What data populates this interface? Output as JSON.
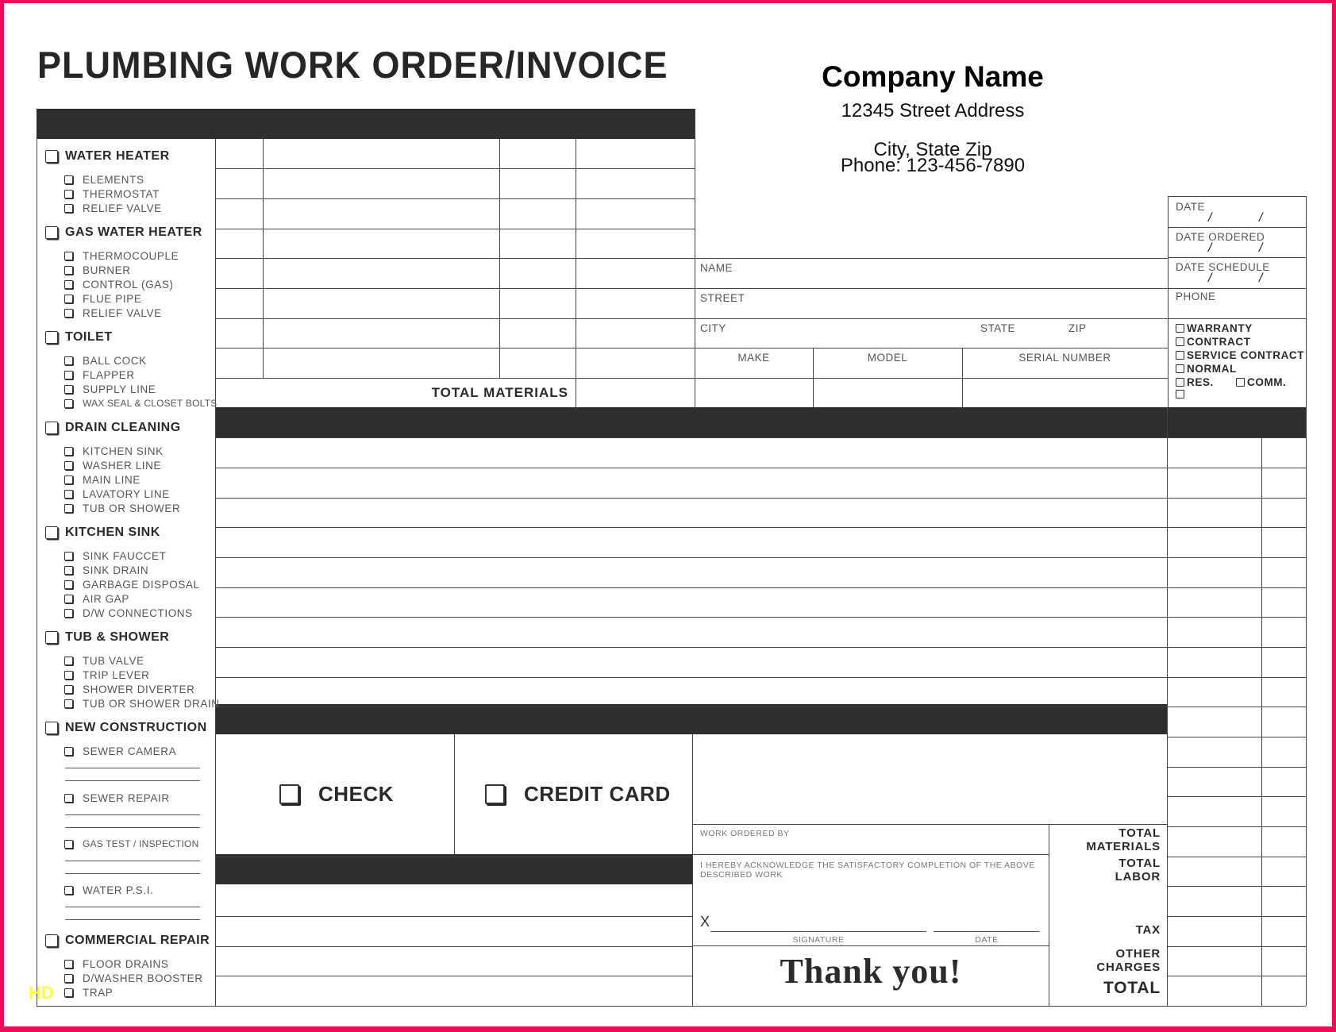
{
  "document": {
    "title": "PLUMBING WORK ORDER/INVOICE",
    "watermark": "HD",
    "colors": {
      "border": "#ee0c58",
      "header_bar": "#2e2e2e"
    }
  },
  "company": {
    "name": "Company Name",
    "street": "12345 Street Address",
    "city_state_zip": "City, State Zip",
    "phone": "Phone: 123-456-7890"
  },
  "services": [
    {
      "category": "WATER HEATER",
      "items": [
        "ELEMENTS",
        "THERMOSTAT",
        "RELIEF VALVE"
      ]
    },
    {
      "category": "GAS WATER HEATER",
      "items": [
        "THERMOCOUPLE",
        "BURNER",
        "CONTROL (GAS)",
        "FLUE PIPE",
        "RELIEF VALVE"
      ]
    },
    {
      "category": "TOILET",
      "items": [
        "BALL COCK",
        "FLAPPER",
        "SUPPLY LINE",
        "WAX SEAL & CLOSET BOLTS"
      ]
    },
    {
      "category": "DRAIN CLEANING",
      "items": [
        "KITCHEN SINK",
        "WASHER LINE",
        "MAIN LINE",
        "LAVATORY LINE",
        "TUB OR SHOWER"
      ]
    },
    {
      "category": "KITCHEN SINK",
      "items": [
        "SINK FAUCCET",
        "SINK DRAIN",
        "GARBAGE DISPOSAL",
        "AIR GAP",
        "D/W CONNECTIONS"
      ]
    },
    {
      "category": "TUB & SHOWER",
      "items": [
        "TUB VALVE",
        "TRIP LEVER",
        "SHOWER DIVERTER",
        "TUB OR SHOWER DRAIN"
      ]
    },
    {
      "category": "NEW CONSTRUCTION",
      "items": [
        "SEWER CAMERA",
        "SEWER REPAIR",
        "GAS TEST / INSPECTION",
        "WATER P.S.I."
      ]
    },
    {
      "category": "COMMERCIAL REPAIR",
      "items": [
        "FLOOR DRAINS",
        "D/WASHER BOOSTER",
        "TRAP"
      ]
    }
  ],
  "materials": {
    "total_label": "TOTAL MATERIALS"
  },
  "customer": {
    "name_label": "NAME",
    "street_label": "STREET",
    "city_label": "CITY",
    "state_label": "STATE",
    "zip_label": "ZIP",
    "make_label": "MAKE",
    "model_label": "MODEL",
    "serial_label": "SERIAL NUMBER"
  },
  "dates": {
    "date_label": "DATE",
    "date_ordered_label": "DATE ORDERED",
    "date_schedule_label": "DATE SCHEDULE",
    "phone_label": "PHONE",
    "separator": "/"
  },
  "options": {
    "warranty": "WARRANTY",
    "contract": "CONTRACT",
    "service_contract": "SERVICE CONTRACT",
    "normal": "NORMAL",
    "res": "RES.",
    "comm": "COMM."
  },
  "payment": {
    "check": "CHECK",
    "credit_card": "CREDIT CARD"
  },
  "signoff": {
    "work_ordered_by": "WORK ORDERED BY",
    "acknowledge": "I HEREBY ACKNOWLEDGE THE SATISFACTORY COMPLETION OF THE ABOVE DESCRIBED WORK",
    "x_mark": "X",
    "signature_label": "SIGNATURE",
    "date_label": "DATE",
    "thanks": "Thank you!"
  },
  "totals": {
    "total_materials": [
      "TOTAL",
      "MATERIALS"
    ],
    "total_labor": [
      "TOTAL",
      "LABOR"
    ],
    "tax": "TAX",
    "other_charges": [
      "OTHER",
      "CHARGES"
    ],
    "total": "TOTAL"
  }
}
